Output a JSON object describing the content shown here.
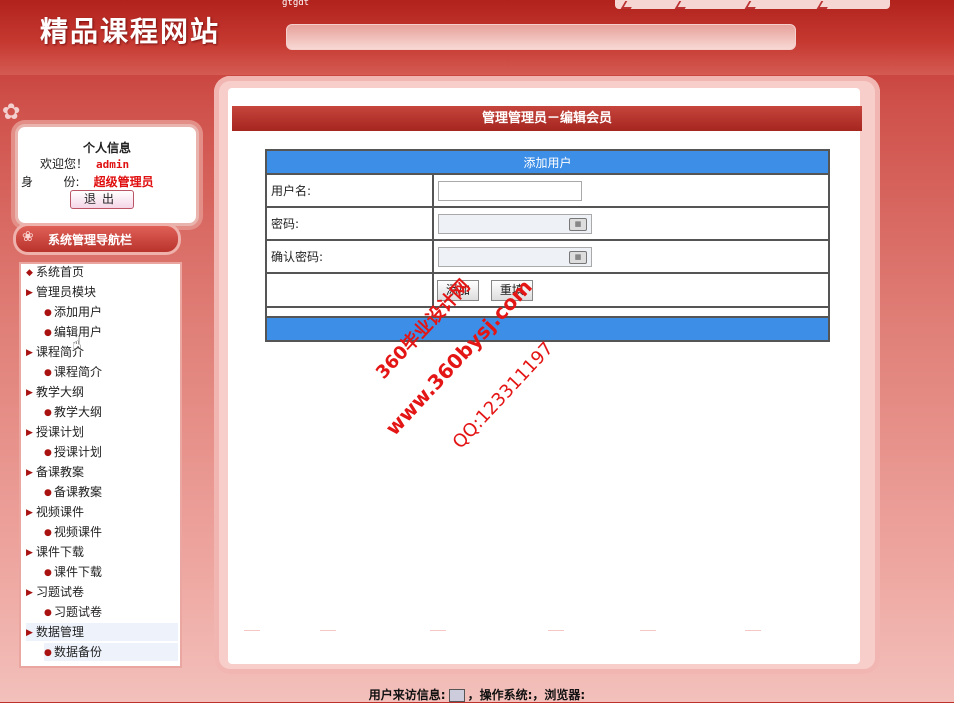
{
  "header": {
    "site_title": "精品课程网站",
    "tiny_text": "gtgdt"
  },
  "user_info": {
    "title": "个人信息",
    "welcome_label": "欢迎您！",
    "username": "admin",
    "identity_label": "身        份:",
    "identity_value": "超级管理员",
    "logout_label": "退出"
  },
  "nav": {
    "header": "系统管理导航栏",
    "items": [
      {
        "label": "系统首页",
        "level": 0
      },
      {
        "label": "管理员模块",
        "level": 0
      },
      {
        "label": "添加用户",
        "level": 1
      },
      {
        "label": "编辑用户",
        "level": 1
      },
      {
        "label": "课程简介",
        "level": 0
      },
      {
        "label": "课程简介",
        "level": 1
      },
      {
        "label": "教学大纲",
        "level": 0
      },
      {
        "label": "教学大纲",
        "level": 1
      },
      {
        "label": "授课计划",
        "level": 0
      },
      {
        "label": "授课计划",
        "level": 1
      },
      {
        "label": "备课教案",
        "level": 0
      },
      {
        "label": "备课教案",
        "level": 1
      },
      {
        "label": "视频课件",
        "level": 0
      },
      {
        "label": "视频课件",
        "level": 1
      },
      {
        "label": "课件下载",
        "level": 0
      },
      {
        "label": "课件下载",
        "level": 1
      },
      {
        "label": "习题试卷",
        "level": 0
      },
      {
        "label": "习题试卷",
        "level": 1
      },
      {
        "label": "数据管理",
        "level": 0
      },
      {
        "label": "数据备份",
        "level": 1
      }
    ]
  },
  "main": {
    "title": "管理管理员－编辑会员",
    "form": {
      "header": "添加用户",
      "username_label": "用户名:",
      "username_value": "",
      "password_label": "密码:",
      "confirm_label": "确认密码:",
      "submit_label": "添加",
      "reset_label": "重填"
    }
  },
  "watermark": {
    "line1": "360毕业设计网",
    "line2": "www.360bysj.com",
    "line3": "QQ:123311197"
  },
  "footer": {
    "visitor_label": "用户来访信息:",
    "os_label": "，操作系统:",
    "browser_label": "，浏览器:"
  },
  "colors": {
    "accent_red": "#b1221d",
    "form_blue": "#3d8ee6",
    "highlight_red": "#e01010"
  }
}
